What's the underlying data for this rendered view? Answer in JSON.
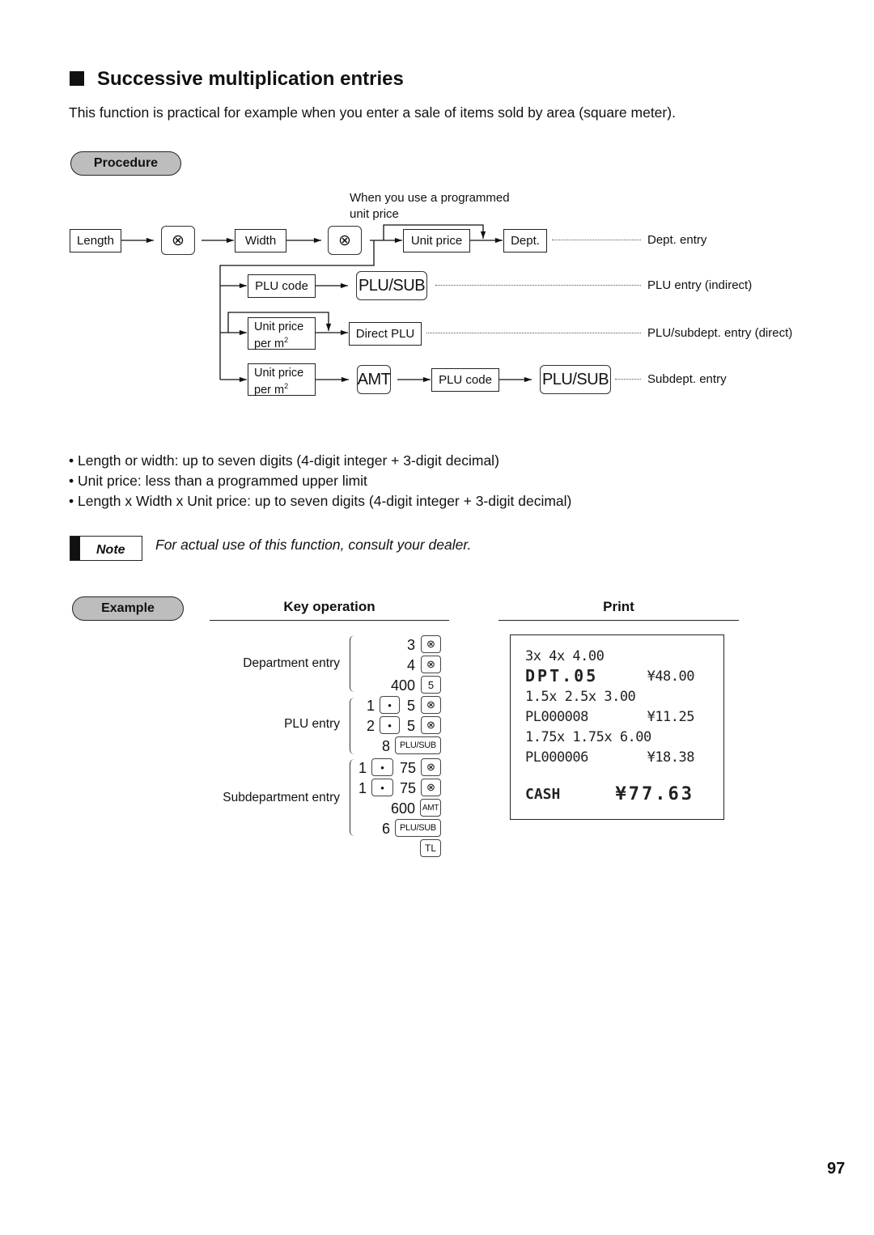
{
  "heading": "Successive multiplication entries",
  "intro": "This function is practical for example when you enter a sale of items sold by area (square meter).",
  "procedure": {
    "label": "Procedure",
    "note_programmed": [
      "When you use a programmed",
      "unit price"
    ],
    "boxes": {
      "length": "Length",
      "width": "Width",
      "unit_price": "Unit price",
      "dept": "Dept.",
      "plu_code_1": "PLU code",
      "unit_price_m2_a": "Unit price",
      "unit_price_m2_b": "per m",
      "direct_plu": "Direct PLU",
      "plu_code_2": "PLU code"
    },
    "keys": {
      "multiply": "⊗",
      "plu_sub": "PLU/SUB",
      "amt": "AMT"
    },
    "superscript": "2",
    "results": {
      "dept_entry": "Dept. entry",
      "plu_indirect": "PLU entry (indirect)",
      "plu_direct": "PLU/subdept. entry (direct)",
      "subdept": "Subdept. entry"
    }
  },
  "bullets": [
    "• Length or width: up to seven digits (4-digit integer + 3-digit decimal)",
    "• Unit price: less than a programmed upper limit",
    "• Length x Width x Unit price: up to seven digits (4-digit integer + 3-digit decimal)"
  ],
  "note": {
    "label": "Note",
    "text": "For actual use of this function, consult your dealer."
  },
  "example": {
    "label": "Example",
    "key_operation_header": "Key operation",
    "print_header": "Print",
    "groups": {
      "department": "Department entry",
      "plu": "PLU entry",
      "subdepartment": "Subdepartment entry"
    },
    "keys": {
      "mult": "⊗",
      "dot": "•",
      "five": "5",
      "plu_sub": "PLU/SUB",
      "amt": "AMT",
      "tl": "TL"
    },
    "sequence": {
      "d1": "3",
      "d2": "4",
      "d3": "400",
      "p1a": "1",
      "p1b": "5",
      "p2a": "2",
      "p2b": "5",
      "p3": "8",
      "s1a": "1",
      "s1b": "75",
      "s2a": "1",
      "s2b": "75",
      "s3": "600",
      "s4": "6"
    },
    "receipt": {
      "l1": "3x 4x 4.00",
      "l2": "DPT.05",
      "l2v": "¥48.00",
      "l3": "1.5x 2.5x 3.00",
      "l4": "PL000008",
      "l4v": "¥11.25",
      "l5": "1.75x 1.75x 6.00",
      "l6": "PL000006",
      "l6v": "¥18.38",
      "l7": "CASH",
      "l7v": "¥77.63"
    }
  },
  "page_number": "97"
}
